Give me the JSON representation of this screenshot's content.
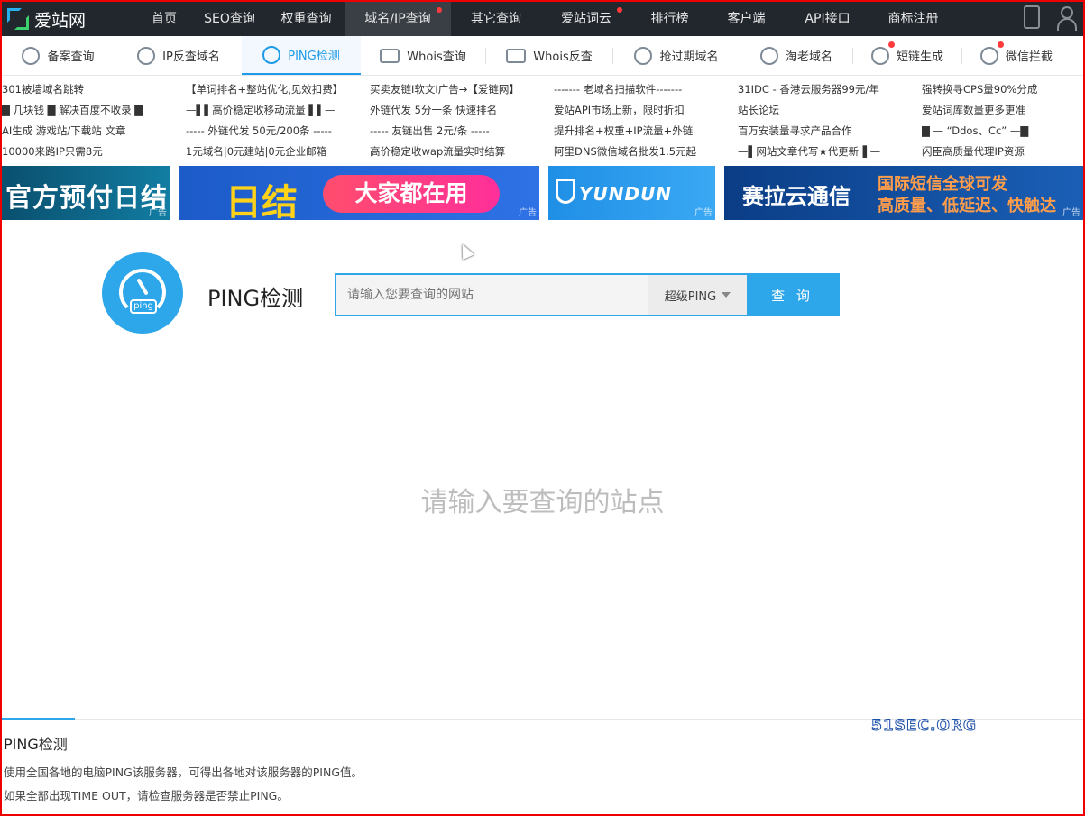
{
  "topnav": {
    "logo": "爱站网",
    "items": [
      {
        "label": "首页",
        "active": false,
        "dot": false
      },
      {
        "label": "SEO查询",
        "active": false,
        "dot": false
      },
      {
        "label": "权重查询",
        "active": false,
        "dot": false
      },
      {
        "label": "域名/IP查询",
        "active": true,
        "dot": true
      },
      {
        "label": "其它查询",
        "active": false,
        "dot": false
      },
      {
        "label": "爱站词云",
        "active": false,
        "dot": true
      },
      {
        "label": "排行榜",
        "active": false,
        "dot": false
      },
      {
        "label": "客户端",
        "active": false,
        "dot": false
      },
      {
        "label": "API接口",
        "active": false,
        "dot": false
      },
      {
        "label": "商标注册",
        "active": false,
        "dot": false
      }
    ]
  },
  "subnav": {
    "items": [
      {
        "label": "备案查询",
        "active": false,
        "icon": "icp-icon",
        "dot": false
      },
      {
        "label": "IP反查域名",
        "active": false,
        "icon": "ip-icon",
        "dot": false
      },
      {
        "label": "PING检测",
        "active": true,
        "icon": "gauge-icon",
        "dot": false
      },
      {
        "label": "Whois查询",
        "active": false,
        "icon": "whois-icon",
        "dot": false
      },
      {
        "label": "Whois反查",
        "active": false,
        "icon": "whois-reverse-icon",
        "dot": false
      },
      {
        "label": "抢过期域名",
        "active": false,
        "icon": "globe-icon",
        "dot": false
      },
      {
        "label": "淘老域名",
        "active": false,
        "icon": "globe-old-icon",
        "dot": false
      },
      {
        "label": "短链生成",
        "active": false,
        "icon": "link-icon",
        "dot": true
      },
      {
        "label": "微信拦截",
        "active": false,
        "icon": "shield-icon",
        "dot": true
      }
    ]
  },
  "text_ads": [
    "301被墙域名跳转",
    "【单词排名+整站优化,见效扣费】",
    "买卖友链I软文I广告→【爱链网】",
    "------- 老域名扫描软件-------",
    "31IDC - 香港云服务器99元/年",
    "强转换寻CPS量90%分成",
    "▇ 几块钱 ▇ 解决百度不收录 ▇",
    "—▌▌高价稳定收移动流量 ▌▌—",
    "外链代发 5分一条 快速排名",
    "爱站API市场上新，限时折扣",
    "站长论坛",
    "爱站词库数量更多更准",
    "AI生成 游戏站/下载站 文章",
    "----- 外链代发 50元/200条 -----",
    "----- 友链出售 2元/条 -----",
    "提升排名+权重+IP流量+外链",
    "百万安装量寻求产品合作",
    "▇ — “Ddos、Cc” —▇",
    "10000来路IP只需8元",
    "1元域名|0元建站|0元企业邮箱",
    "高价稳定收wap流量实时结算",
    "阿里DNS微信域名批发1.5元起",
    "—▌网站文章代写★代更新▐ —",
    "闪臣高质量代理IP资源"
  ],
  "banners": {
    "ad_label": "广告",
    "b1": "官方预付日结",
    "b2_left": "日结",
    "b2_pill": "大家都在用",
    "b3": "YUNDUN",
    "b4_left": "赛拉云通信",
    "b4_right1": "国际短信全球可发",
    "b4_right2": "高质量、低延迟、快触达"
  },
  "main": {
    "title": "PING检测",
    "logo_label": "ping",
    "search_placeholder": "请输入您要查询的网站",
    "select_value": "超级PING",
    "search_button": "查 询",
    "empty_message": "请输入要查询的站点"
  },
  "info": {
    "title": "PING检测",
    "p1": "使用全国各地的电脑PING该服务器，可得出各地对该服务器的PING值。",
    "p2": "如果全部出现TIME OUT，请检查服务器是否禁止PING。",
    "watermark": "51SEC.ORG"
  }
}
